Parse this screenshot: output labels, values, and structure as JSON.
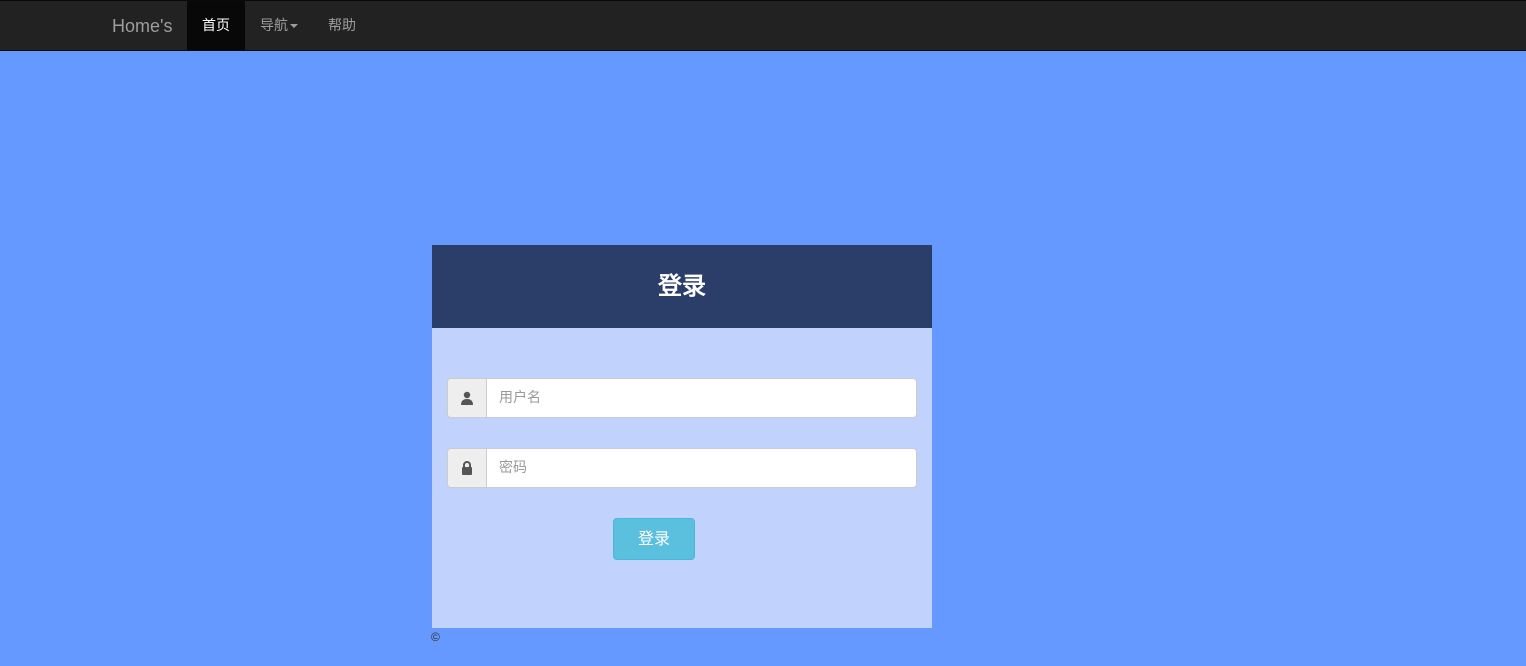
{
  "navbar": {
    "brand": "Home's",
    "items": [
      {
        "label": "首页",
        "active": true
      },
      {
        "label": "导航",
        "dropdown": true
      },
      {
        "label": "帮助"
      }
    ]
  },
  "login": {
    "title": "登录",
    "username": {
      "placeholder": "用户名",
      "value": "",
      "icon": "user-icon"
    },
    "password": {
      "placeholder": "密码",
      "value": "",
      "icon": "lock-icon"
    },
    "submit_label": "登录"
  },
  "footer": {
    "copyright": "©"
  },
  "colors": {
    "page_background": "#6699ff",
    "navbar": "#222222",
    "card_header": "#2b3e6a",
    "card_body": "#c1d3fd",
    "button": "#5bc0de"
  }
}
